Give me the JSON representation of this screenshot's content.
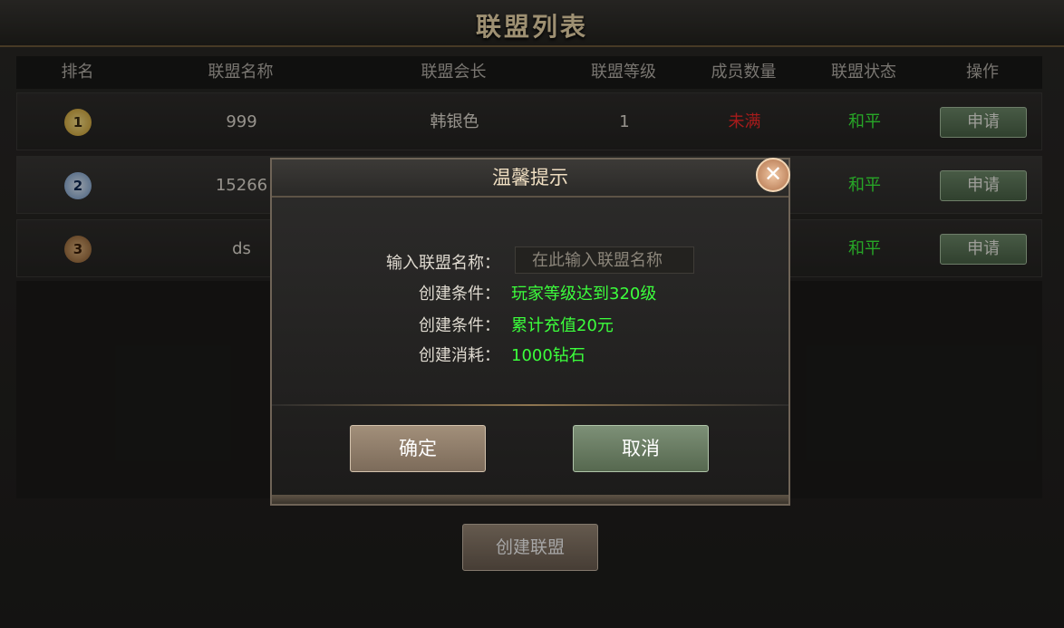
{
  "window": {
    "title": "联盟列表"
  },
  "table": {
    "headers": [
      "排名",
      "联盟名称",
      "联盟会长",
      "联盟等级",
      "成员数量",
      "联盟状态",
      "操作"
    ],
    "rows": [
      {
        "rank": "1",
        "name": "999",
        "leader": "韩银色",
        "level": "1",
        "members": "未满",
        "status": "和平",
        "action": "申请"
      },
      {
        "rank": "2",
        "name": "15266",
        "status": "和平",
        "action": "申请"
      },
      {
        "rank": "3",
        "name": "ds",
        "status": "和平",
        "action": "申请"
      }
    ]
  },
  "create_button": "创建联盟",
  "dialog": {
    "title": "温馨提示",
    "name_label": "输入联盟名称：",
    "name_placeholder": "在此输入联盟名称",
    "conditions": [
      {
        "label": "创建条件：",
        "value": "玩家等级达到320级"
      },
      {
        "label": "创建条件：",
        "value": "累计充值20元"
      },
      {
        "label": "创建消耗：",
        "value": "1000钻石"
      }
    ],
    "ok": "确定",
    "cancel": "取消"
  },
  "colors": {
    "green": "#3cff3c",
    "red": "#ff2a2a",
    "gold_text": "#f3ddb0"
  }
}
